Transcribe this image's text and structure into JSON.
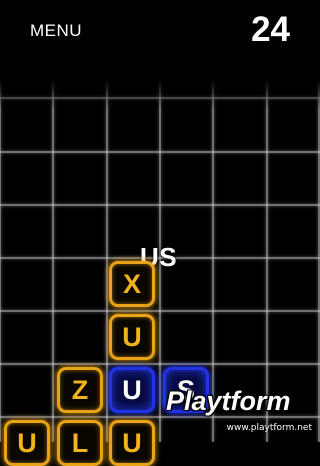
{
  "header": {
    "menu_label": "MENU",
    "score": "24"
  },
  "current_word": "US",
  "tiles": [
    {
      "letter": "X",
      "style": "orange"
    },
    {
      "letter": "U",
      "style": "orange"
    },
    {
      "letter": "Z",
      "style": "orange"
    },
    {
      "letter": "U",
      "style": "blue"
    },
    {
      "letter": "S",
      "style": "blue"
    },
    {
      "letter": "U",
      "style": "orange"
    },
    {
      "letter": "L",
      "style": "orange"
    },
    {
      "letter": "U",
      "style": "orange"
    }
  ],
  "colors": {
    "tile_orange": "#e8a317",
    "tile_blue": "#2233e6",
    "grid_line": "#ffffff",
    "background": "#000000"
  },
  "watermark": {
    "brand": "Playtform",
    "url": "www.playtform.net"
  }
}
